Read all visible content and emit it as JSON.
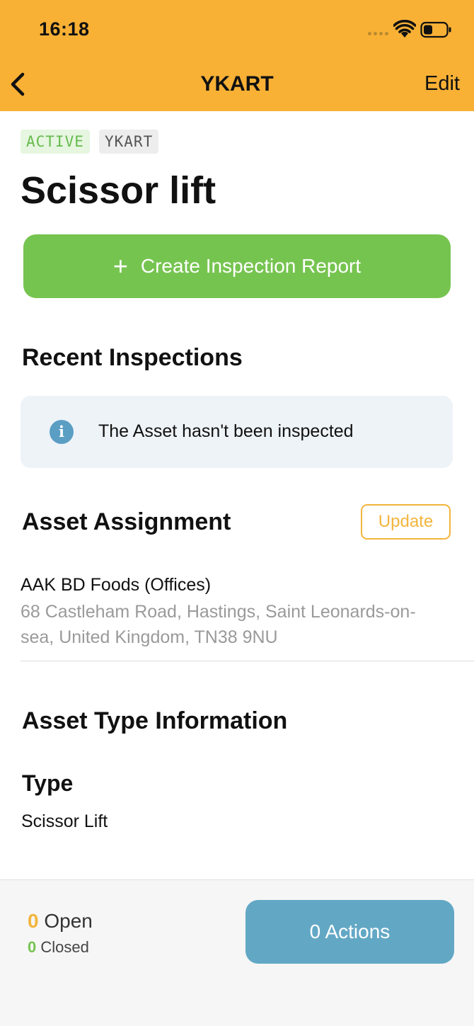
{
  "status_bar": {
    "time": "16:18"
  },
  "nav": {
    "title": "YKART",
    "edit_label": "Edit"
  },
  "badges": {
    "status": "ACTIVE",
    "code": "YKART"
  },
  "asset": {
    "title": "Scissor lift"
  },
  "create_button": {
    "icon": "+",
    "label": "Create Inspection Report"
  },
  "recent_inspections": {
    "heading": "Recent Inspections",
    "info_icon": "i",
    "empty_message": "The Asset hasn't been inspected"
  },
  "assignment": {
    "heading": "Asset Assignment",
    "update_label": "Update",
    "name": "AAK BD Foods (Offices)",
    "address": "68 Castleham Road, Hastings, Saint Leonards-on-sea, United Kingdom, TN38 9NU"
  },
  "type_info": {
    "heading": "Asset Type Information",
    "type_label": "Type",
    "type_value": "Scissor Lift"
  },
  "footer": {
    "open_count": "0",
    "open_label": "Open",
    "closed_count": "0",
    "closed_label": "Closed",
    "actions_label": "0 Actions"
  },
  "colors": {
    "header": "#F8B135",
    "primary_green": "#76C450",
    "accent_orange": "#F3B53C",
    "actions_blue": "#62A8C5",
    "info_blue": "#5A9EC4"
  },
  "icons": [
    "back-chevron-icon",
    "wifi-icon",
    "battery-icon",
    "plus-icon",
    "info-icon"
  ]
}
